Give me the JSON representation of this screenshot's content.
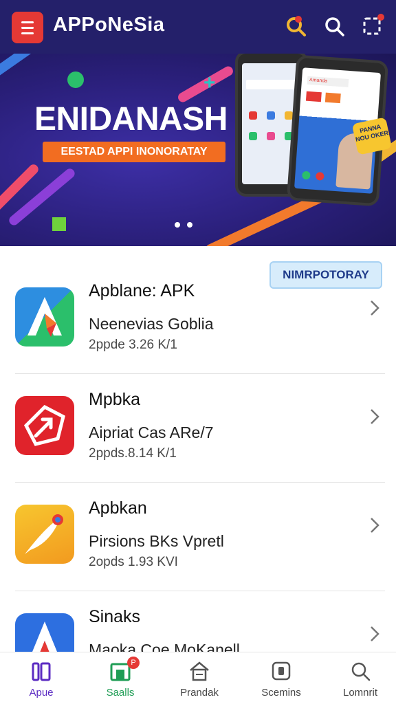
{
  "appbar": {
    "title": "APPoNeSia",
    "icons": [
      "menu-icon",
      "discover-icon",
      "search-icon",
      "scan-icon"
    ]
  },
  "hero": {
    "title": "ENIDANASH",
    "pill": "EESTAD APPI INONORATAY",
    "badge": "PANNA NOU OKER",
    "screen_chip": "Amanda",
    "slides": 2
  },
  "list": {
    "tag": "NIMRPOTORAY",
    "items": [
      {
        "title": "Apblane: APK",
        "subtitle": "Neenevias Goblia",
        "meta": "2ppde 3.26 K/1",
        "icon": "arrow-app-icon"
      },
      {
        "title": "Mpbka",
        "subtitle": "Aipriat Cas ARe/7",
        "meta": "2ppds.8.14 K/1",
        "icon": "share-app-icon"
      },
      {
        "title": "Apbkan",
        "subtitle": "Pirsions BKs Vpretl",
        "meta": "2opds 1.93 KVI",
        "icon": "feather-app-icon"
      },
      {
        "title": "Sinaks",
        "subtitle": "Maoka Coe MoKanell",
        "meta": "",
        "icon": "letter-a-app-icon"
      }
    ]
  },
  "nav": {
    "items": [
      {
        "label": "Apue",
        "icon": "apps-icon",
        "color": "#5b2bc2"
      },
      {
        "label": "Saalls",
        "icon": "store-icon",
        "color": "#1f9d55",
        "badge": "P"
      },
      {
        "label": "Prandak",
        "icon": "home-icon",
        "color": "#555555"
      },
      {
        "label": "Scemins",
        "icon": "camera-icon",
        "color": "#555555"
      },
      {
        "label": "Lomnrit",
        "icon": "search-icon",
        "color": "#555555"
      }
    ]
  },
  "colors": {
    "appbar": "#24206a",
    "accent": "#e53935",
    "pill": "#f26d21"
  }
}
